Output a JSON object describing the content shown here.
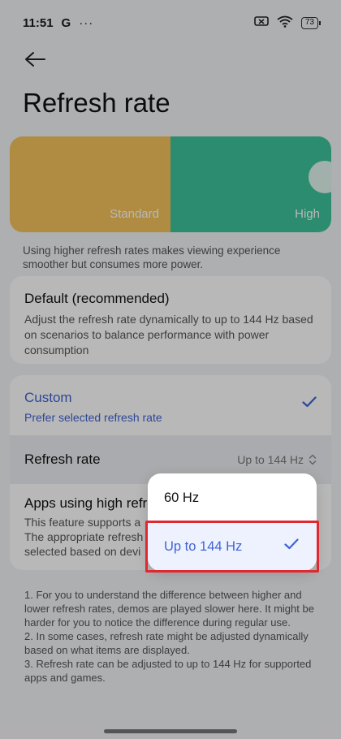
{
  "status": {
    "time": "11:51",
    "carrier_glyph": "G",
    "more": "···",
    "battery": "73"
  },
  "header": {
    "title": "Refresh rate"
  },
  "preview": {
    "standard_label": "Standard",
    "high_label": "High",
    "colors": {
      "standard": "#f3c35a",
      "high": "#3ec29a"
    }
  },
  "description": "Using higher refresh rates makes viewing experience smoother but consumes more power.",
  "default_option": {
    "title": "Default (recommended)",
    "subtitle": "Adjust the refresh rate dynamically to up to 144 Hz based on scenarios to balance performance with power consumption"
  },
  "custom_option": {
    "title": "Custom",
    "subtitle": "Prefer selected refresh rate",
    "selected": true
  },
  "refresh_rate_row": {
    "label": "Refresh rate",
    "value": "Up to 144 Hz"
  },
  "apps_row": {
    "title": "Apps using high refre",
    "line1": "This feature supports a",
    "line2": "The appropriate refresh",
    "line3": "selected based on devi"
  },
  "notes": [
    "1. For you to understand the difference between higher and lower refresh rates, demos are played slower here. It might be harder for you to notice the difference during regular use.",
    "2. In some cases, refresh rate might be adjusted dynamically based on what items are displayed.",
    "3. Refresh rate can be adjusted to up to 144 Hz for supported apps and games."
  ],
  "popup": {
    "options": [
      "60 Hz",
      "Up to 144 Hz"
    ],
    "selected": "Up to 144 Hz"
  },
  "accent_color": "#3f63d3",
  "highlight_color": "#e0282f"
}
